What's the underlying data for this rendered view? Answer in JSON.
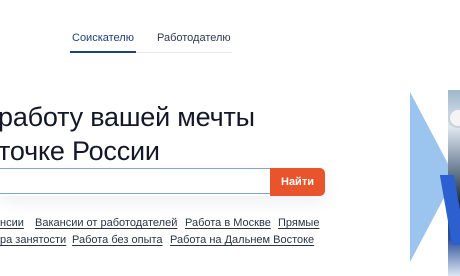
{
  "tabs": [
    {
      "label": "Соискателю",
      "active": true
    },
    {
      "label": "Работодателю",
      "active": false
    }
  ],
  "headline": {
    "line1": "работу вашей мечты",
    "line2": "точке России"
  },
  "search": {
    "input_value": "",
    "input_placeholder": "",
    "button_label": "Найти"
  },
  "links": {
    "row1": [
      "нсии",
      "Вакансии от работодателей",
      "Работа в Москве",
      "Прямые"
    ],
    "row2": [
      "ра занятости",
      "Работа без опыта",
      "Работа на Дальнем Востоке"
    ]
  },
  "colors": {
    "accent_orange": "#e8542b",
    "tab_active": "#1f3f79",
    "link_text": "#2b3442",
    "hero_blue": "#9bc4ef"
  }
}
